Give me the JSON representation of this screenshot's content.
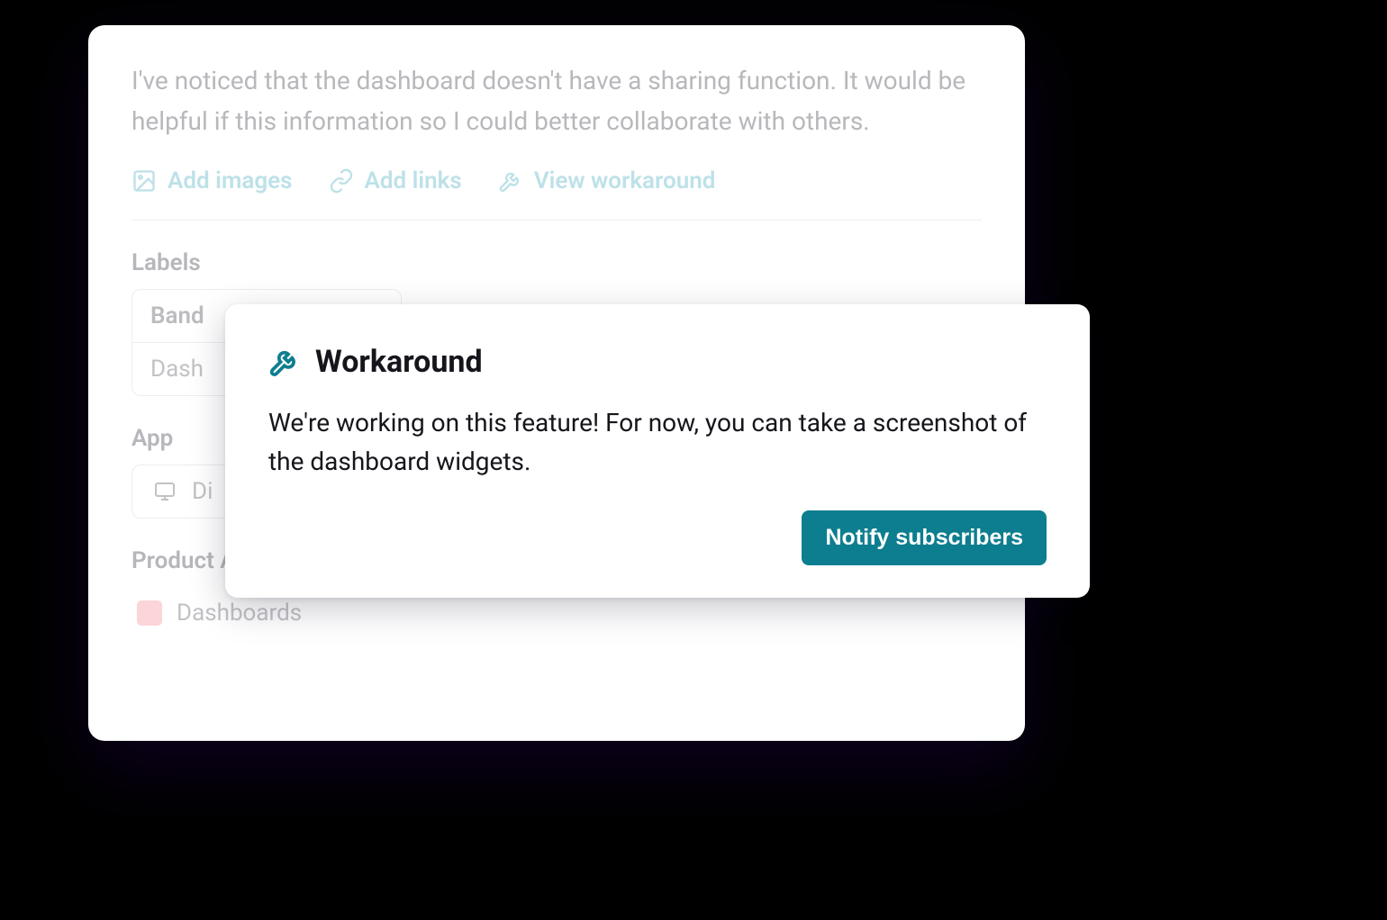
{
  "description": "I've noticed that the dashboard doesn't have a sharing function. It would be helpful if this information so I could better collaborate with others.",
  "actions": {
    "add_images": "Add images",
    "add_links": "Add links",
    "view_workaround": "View workaround"
  },
  "sections": {
    "labels": {
      "title": "Labels",
      "items": [
        "Band",
        "Dash"
      ]
    },
    "app": {
      "title": "App",
      "item": "Di"
    },
    "product_area": {
      "title": "Product Area",
      "item": "Dashboards",
      "swatch_color": "#fbd5d7"
    }
  },
  "popup": {
    "title": "Workaround",
    "body": "We're working on this feature! For now, you can take a screenshot of the dashboard widgets.",
    "button": "Notify subscribers"
  }
}
